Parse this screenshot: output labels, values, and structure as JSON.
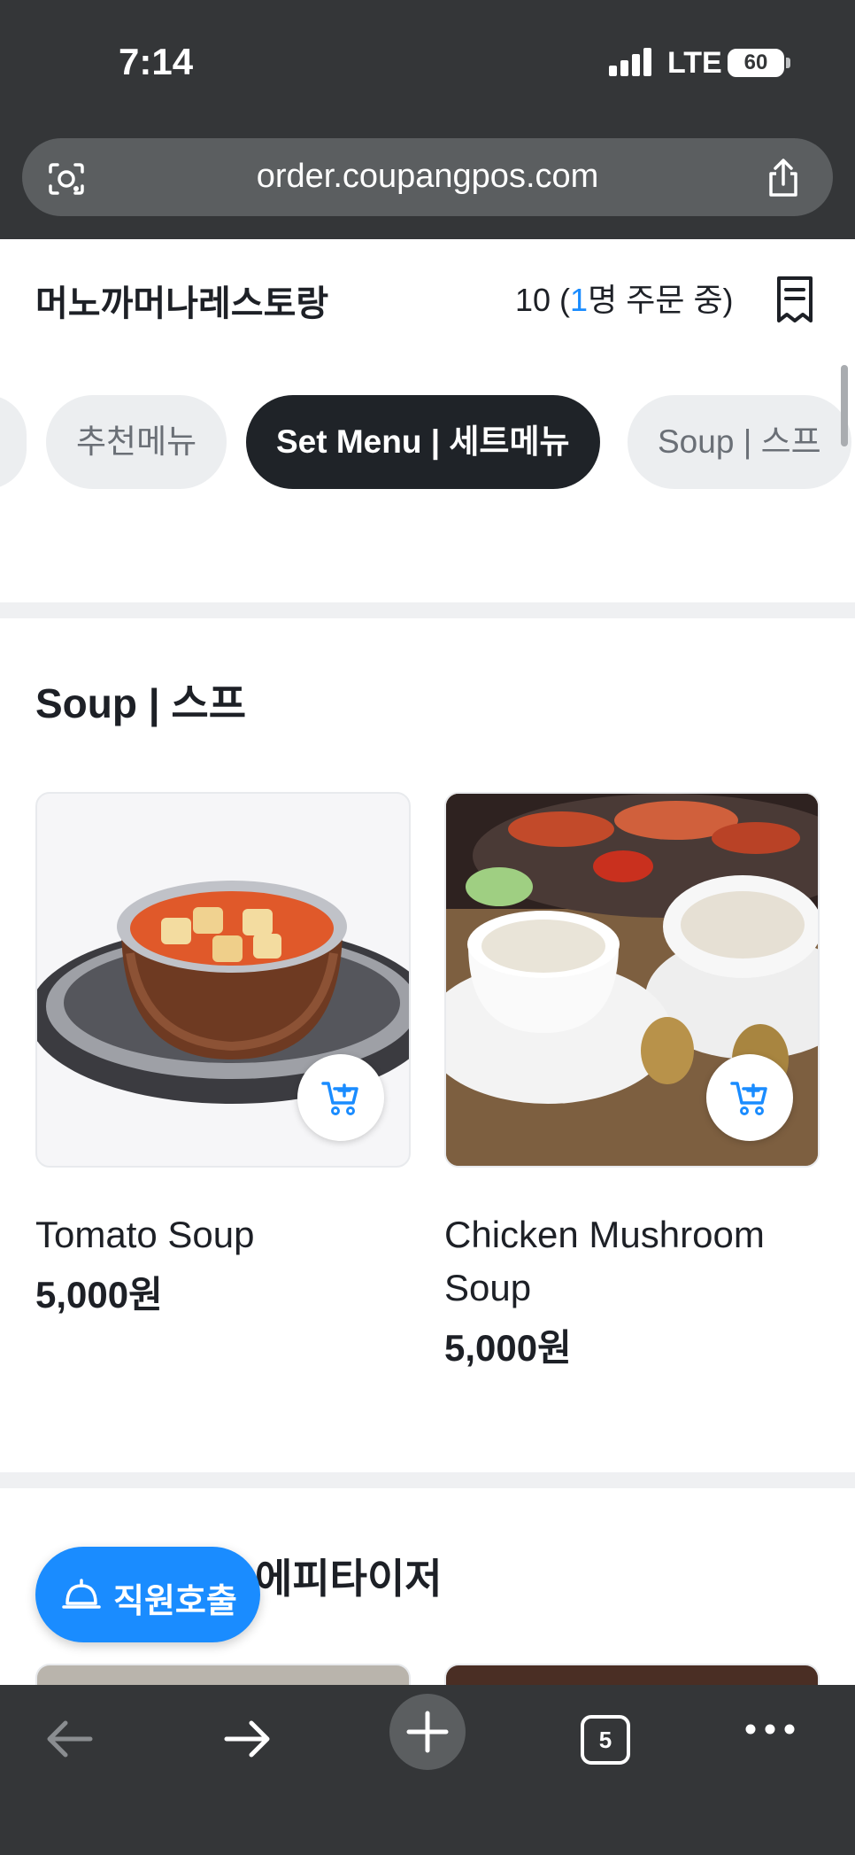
{
  "status_bar": {
    "time": "7:14",
    "network": "LTE",
    "battery": "60"
  },
  "browser": {
    "url": "order.coupangpos.com",
    "tab_count": "5"
  },
  "restaurant": {
    "name": "머노까머나레스토랑",
    "table_number": "10",
    "table_open_paren": " (",
    "ordering_count": "1",
    "ordering_suffix": "명 주문 중)"
  },
  "categories": [
    {
      "label": "추천메뉴",
      "active": false
    },
    {
      "label": "Set Menu | 세트메뉴",
      "active": true
    },
    {
      "label": "Soup | 스프",
      "active": false
    }
  ],
  "sections": [
    {
      "title": "Soup | 스프",
      "items": [
        {
          "name": "Tomato Soup",
          "price": "5,000원"
        },
        {
          "name": "Chicken Mushroom Soup",
          "price": "5,000원"
        }
      ]
    },
    {
      "title": "Appetizer | 에피타이저"
    }
  ],
  "call_staff": {
    "label": "직원호출"
  },
  "colors": {
    "accent": "#1a8cff",
    "chrome": "#343638",
    "active_chip": "#1f2328"
  },
  "icons": {
    "url_left": "lens-icon",
    "url_right": "share-icon",
    "header_right": "receipt-icon",
    "card_action": "add-to-cart-icon",
    "call_button": "bell-icon",
    "toolbar": [
      "back-arrow-icon",
      "forward-arrow-icon",
      "new-tab-plus-icon",
      "tabs-count-icon",
      "more-dots-icon"
    ]
  }
}
